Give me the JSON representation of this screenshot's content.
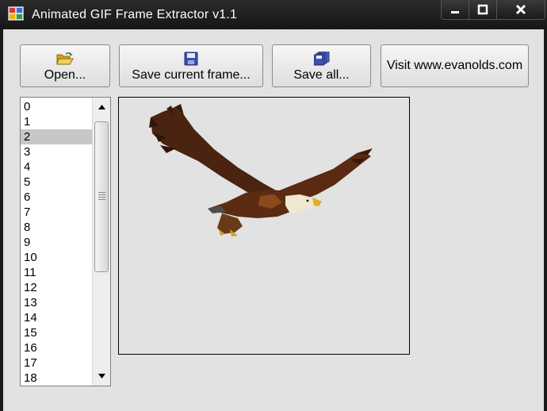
{
  "window": {
    "title": "Animated GIF Frame Extractor v1.1"
  },
  "toolbar": {
    "open_label": "Open...",
    "save_current_label": "Save current frame...",
    "save_all_label": "Save all...",
    "visit_label": "Visit www.evanolds.com"
  },
  "frames": {
    "items": [
      "0",
      "1",
      "2",
      "3",
      "4",
      "5",
      "6",
      "7",
      "8",
      "9",
      "10",
      "11",
      "12",
      "13",
      "14",
      "15",
      "16",
      "17",
      "18"
    ],
    "selected": "2"
  },
  "icons": {
    "app": "app-icon",
    "open": "folder-open-icon",
    "save": "floppy-disk-icon",
    "save_all": "multiple-floppy-icon"
  }
}
